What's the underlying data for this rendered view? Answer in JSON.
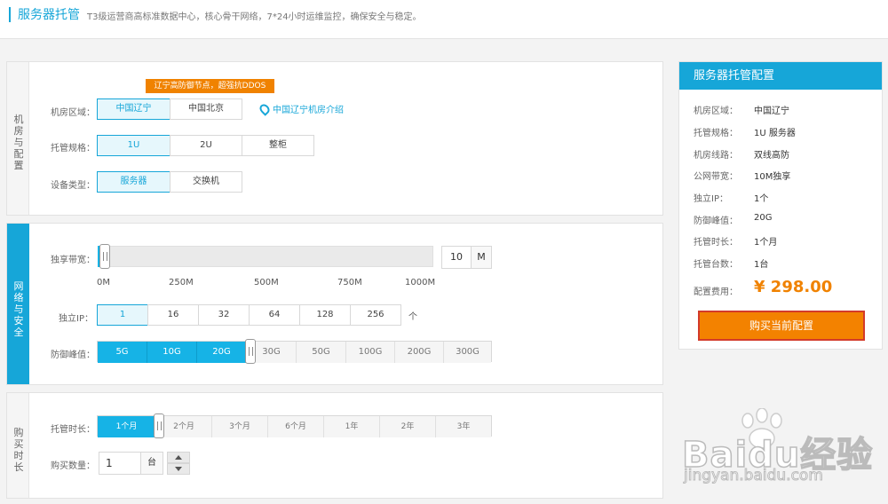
{
  "header": {
    "title": "服务器托管",
    "subtitle": "T3级运营商高标准数据中心，核心骨干网络，7*24小时运维监控，确保安全与稳定。"
  },
  "room_section": {
    "side_label": "机房与配置",
    "promo_tip": "辽宁高防御节点，超强抗DDOS",
    "region_label": "机房区域：",
    "regions": [
      "中国辽宁",
      "中国北京"
    ],
    "region_selected": "中国辽宁",
    "room_link": "中国辽宁机房介绍",
    "spec_label": "托管规格：",
    "specs": [
      "1U",
      "2U",
      "整柜"
    ],
    "spec_selected": "1U",
    "device_label": "设备类型：",
    "devices": [
      "服务器",
      "交换机"
    ],
    "device_selected": "服务器"
  },
  "network_section": {
    "side_label": "网络与安全",
    "bandwidth_label": "独享带宽：",
    "bandwidth_ticks": [
      "0M",
      "250M",
      "500M",
      "750M",
      "1000M"
    ],
    "bandwidth_value": "10",
    "bandwidth_unit": "M",
    "ip_label": "独立IP：",
    "ip_options": [
      "1",
      "16",
      "32",
      "64",
      "128",
      "256"
    ],
    "ip_selected": "1",
    "ip_unit": "个",
    "defense_label": "防御峰值：",
    "defense_options": [
      "5G",
      "10G",
      "20G",
      "30G",
      "50G",
      "100G",
      "200G",
      "300G"
    ],
    "defense_selected_index": 2
  },
  "purchase_section": {
    "side_label": "购买时长",
    "duration_label": "托管时长：",
    "durations": [
      "1个月",
      "2个月",
      "3个月",
      "6个月",
      "1年",
      "2年",
      "3年"
    ],
    "duration_selected_index": 0,
    "qty_label": "购买数量：",
    "qty_value": "1",
    "qty_unit": "台"
  },
  "summary": {
    "title": "服务器托管配置",
    "rows": [
      {
        "label": "机房区域：",
        "value": "中国辽宁"
      },
      {
        "label": "托管规格：",
        "value": "1U 服务器"
      },
      {
        "label": "机房线路：",
        "value": "双线高防"
      },
      {
        "label": "公网带宽：",
        "value": "10M独享"
      },
      {
        "label": "独立IP：",
        "value": "1个"
      },
      {
        "label": "防御峰值：",
        "value": "20G"
      },
      {
        "label": "托管时长：",
        "value": "1个月"
      },
      {
        "label": "托管台数：",
        "value": "1台"
      }
    ],
    "price_label": "配置费用：",
    "price": "¥ 298.00",
    "buy_button": "购买当前配置"
  },
  "watermark": {
    "brand": "Baidu经验",
    "url": "jingyan.baidu.com"
  },
  "colors": {
    "accent": "#16a6d8",
    "orange": "#f08200",
    "segment_on": "#16b3e6"
  }
}
